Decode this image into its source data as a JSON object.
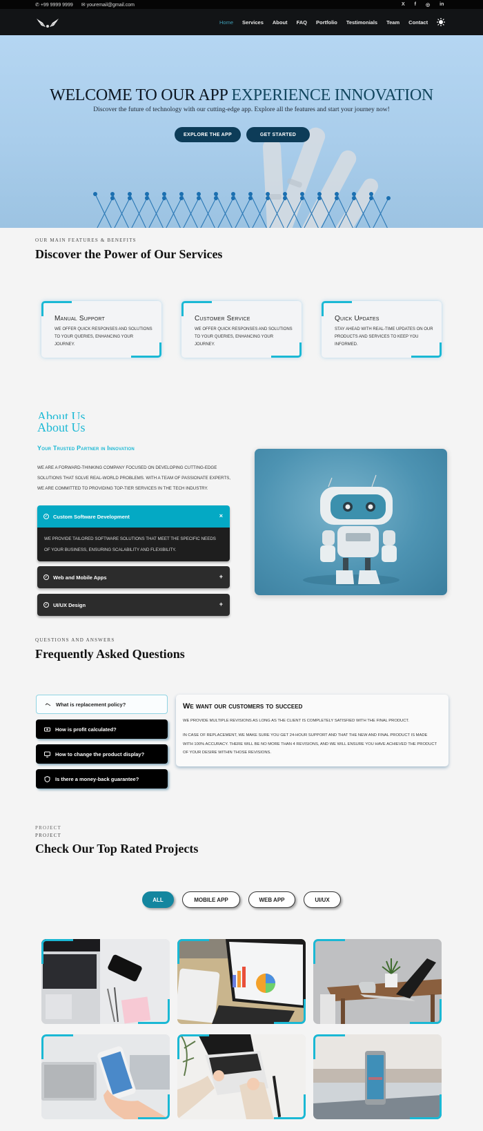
{
  "topbar": {
    "phone": "+99 9999 9999",
    "email": "youremail@gmail.com",
    "social": [
      {
        "icon": "x-icon",
        "label": "X"
      },
      {
        "icon": "facebook-icon",
        "label": "f"
      },
      {
        "icon": "instagram-icon",
        "label": "◎"
      },
      {
        "icon": "linkedin-icon",
        "label": "in"
      }
    ]
  },
  "nav": {
    "logo": "wings-logo",
    "items": [
      "Home",
      "Services",
      "About",
      "FAQ",
      "Portfolio",
      "Testimonials",
      "Team",
      "Contact"
    ],
    "active": "Home",
    "theme_toggle": "sun-icon"
  },
  "hero": {
    "title_main": "WELCOME TO OUR APP ",
    "title_highlight": "EXPERIENCE INNOVATION",
    "subtitle": "Discover the future of technology with our cutting-edge app. Explore all the features and start your journey now!",
    "buttons": [
      "EXPLORE THE APP",
      "GET STARTED"
    ]
  },
  "services": {
    "eyebrow": "OUR MAIN FEATURES & BENEFITS",
    "title": "Discover the Power of Our Services",
    "cards": [
      {
        "title": "Manual Support",
        "text": "We offer quick responses and solutions to your queries, enhancing your journey."
      },
      {
        "title": "Customer Service",
        "text": "We offer quick responses and solutions to your queries, enhancing your journey."
      },
      {
        "title": "Quick Updates",
        "text": "Stay ahead with real-time updates on our products and services to keep you informed."
      }
    ]
  },
  "about": {
    "ghost_title": "About Us",
    "title": "About Us",
    "subtitle": "Your Trusted Partner in Innovation",
    "text": "We are a forward-thinking company focused on developing cutting-edge solutions that solve real-world problems. With a team of passionate experts, we are committed to providing top-tier services in the tech industry.",
    "accordion": [
      {
        "title": "Custom Software Development",
        "open": true,
        "toggle": "×",
        "body": "We provide tailored software solutions that meet the specific needs of your business, ensuring scalability and flexibility."
      },
      {
        "title": "Web and Mobile Apps",
        "open": false,
        "toggle": "+"
      },
      {
        "title": "UI/UX Design",
        "open": false,
        "toggle": "+"
      }
    ],
    "image": "robot-image"
  },
  "faq": {
    "eyebrow": "QUESTIONS AND ANSWERS",
    "title": "Frequently Asked Questions",
    "questions": [
      {
        "icon": "handshake-icon",
        "text": "What is replacement policy?",
        "active": true
      },
      {
        "icon": "money-icon",
        "text": "How is profit calculated?",
        "active": false
      },
      {
        "icon": "monitor-icon",
        "text": "How to change the product display?",
        "active": false
      },
      {
        "icon": "shield-icon",
        "text": "Is there a money-back guarantee?",
        "active": false
      }
    ],
    "answer": {
      "title": "We want our customers to succeed",
      "p1": "We provide multiple revisions as long as the client is completely satisfied with the final product.",
      "p2": "In case of replacement, we make sure you get 24-hour support and that the new and final product is made with 100% accuracy. There will be no more than 4 revisions, and we will ensure you have achieved the product of your desire within those revisions."
    }
  },
  "projects": {
    "eyebrow_ghost": "PROJECT",
    "eyebrow": "PROJECT",
    "title": "Check Our Top Rated Projects",
    "filters": [
      "ALL",
      "MOBILE APP",
      "WEB APP",
      "UI/UX"
    ],
    "active_filter": "ALL",
    "items": [
      "laptop-phone-desk",
      "laptop-charts-tablet",
      "laptop-table-plant",
      "hand-holding-phone",
      "typing-on-laptop",
      "phone-on-table"
    ]
  },
  "colors": {
    "accent": "#1ab8d4",
    "hero_button": "#0d3c58",
    "filter_active": "#14869f",
    "nav_bg": "#121416"
  }
}
